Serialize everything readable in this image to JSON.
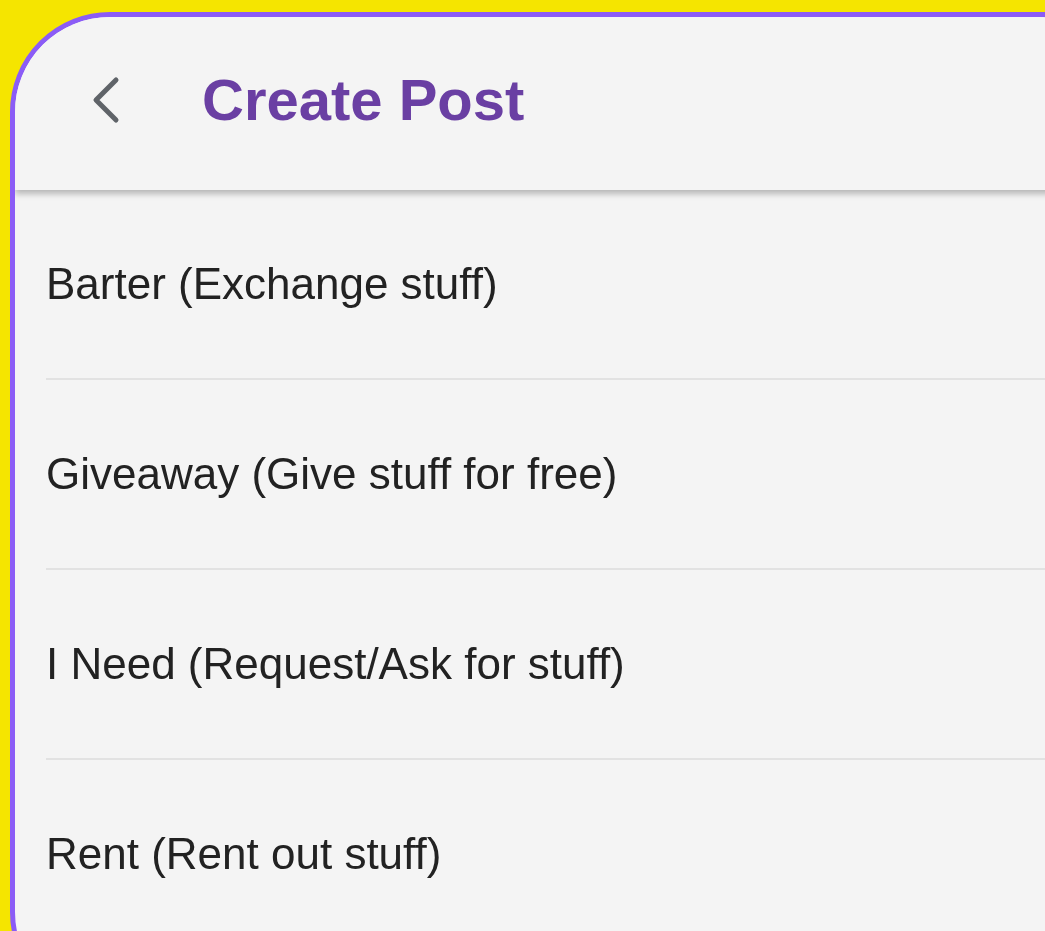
{
  "header": {
    "title": "Create Post"
  },
  "options": [
    {
      "label": "Barter (Exchange stuff)"
    },
    {
      "label": "Giveaway (Give stuff for free)"
    },
    {
      "label": "I Need (Request/Ask for stuff)"
    },
    {
      "label": "Rent (Rent out stuff)"
    }
  ]
}
